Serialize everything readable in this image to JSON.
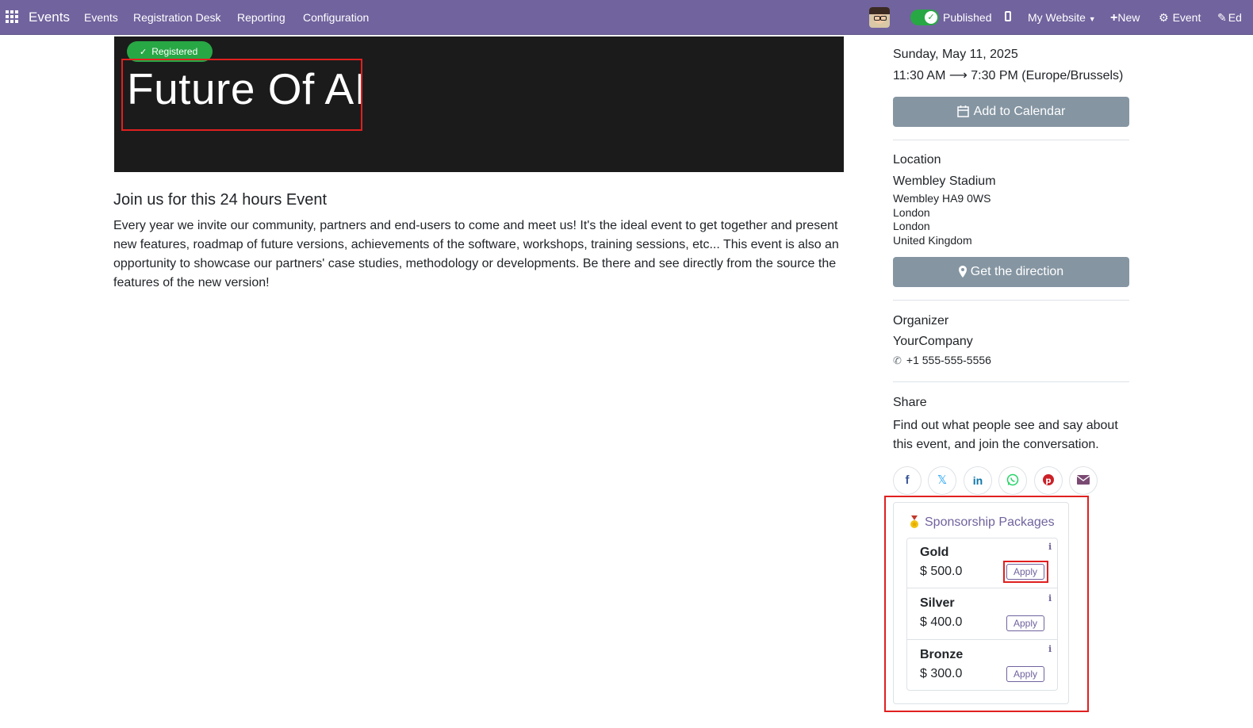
{
  "navbar": {
    "app_name": "Events",
    "menus": [
      "Events",
      "Registration Desk",
      "Reporting",
      "Configuration"
    ],
    "published_label": "Published",
    "website_label": "My Website",
    "new_label": "New",
    "event_label": "Event",
    "edit_label": "Ed",
    "brand_color": "#71639e"
  },
  "hero": {
    "badge": "Registered",
    "title": "Future Of AI"
  },
  "main": {
    "subheading": "Join us for this 24 hours Event",
    "description": "Every year we invite our community, partners and end-users to come and meet us! It's the ideal event to get together and present new features, roadmap of future versions, achievements of the software, workshops, training sessions, etc... This event is also an opportunity to showcase our partners' case studies, methodology or developments. Be there and see directly from the source the features of the new version!"
  },
  "sidebar": {
    "date": "Sunday, May 11, 2025",
    "time_start": "11:30 AM",
    "time_end": "7:30 PM (Europe/Brussels)",
    "add_calendar": "Add to Calendar",
    "location_label": "Location",
    "venue": "Wembley Stadium",
    "address": [
      "Wembley HA9 0WS",
      "London",
      "London",
      "United Kingdom"
    ],
    "direction_button": "Get the direction",
    "organizer_label": "Organizer",
    "organizer": "YourCompany",
    "phone": "+1 555-555-5556",
    "share_label": "Share",
    "share_text": "Find out what people see and say about this event, and join the conversation.",
    "social_icons": [
      "facebook-icon",
      "x-twitter-icon",
      "linkedin-icon",
      "whatsapp-icon",
      "pinterest-icon",
      "email-icon"
    ]
  },
  "sponsorship": {
    "title": "Sponsorship Packages",
    "packages": [
      {
        "name": "Gold",
        "price": "$ 500.0",
        "apply": "Apply"
      },
      {
        "name": "Silver",
        "price": "$ 400.0",
        "apply": "Apply"
      },
      {
        "name": "Bronze",
        "price": "$ 300.0",
        "apply": "Apply"
      }
    ]
  }
}
